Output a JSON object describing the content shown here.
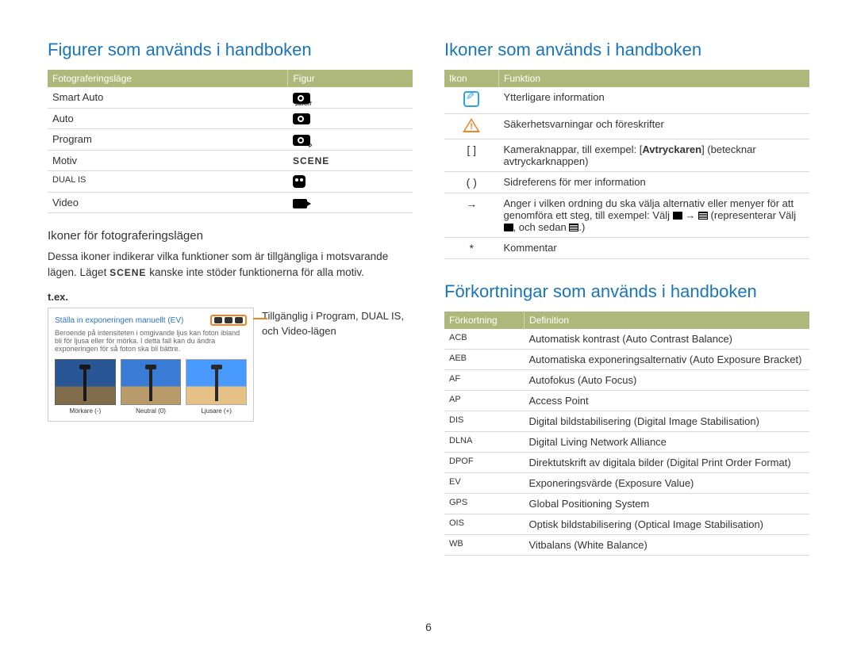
{
  "page_number": "6",
  "left": {
    "heading": "Figurer som används i handboken",
    "table": {
      "cols": [
        "Fotograferingsläge",
        "Figur"
      ],
      "rows": [
        {
          "mode": "Smart Auto",
          "figure": "camera-smart"
        },
        {
          "mode": "Auto",
          "figure": "camera"
        },
        {
          "mode": "Program",
          "figure": "camera-p"
        },
        {
          "mode": "Motiv",
          "figure": "scene"
        },
        {
          "mode": "DUAL IS",
          "figure": "dual-is"
        },
        {
          "mode": "Video",
          "figure": "video"
        }
      ]
    },
    "sub_heading": "Ikoner för fotograferingslägen",
    "intro_pre": "Dessa ikoner indikerar vilka funktioner som är tillgängliga i motsvarande lägen. Läget ",
    "intro_scene_word": "SCENE",
    "intro_post": " kanske inte stöder funktionerna för alla motiv.",
    "tex": "t.ex.",
    "example": {
      "title": "Ställa in exponeringen manuellt (EV)",
      "blurb": "Beroende på intensiteten i omgivande ljus kan foton ibland bli för ljusa eller för mörka. I detta fall kan du ändra exponeringen för så foton ska bli bättre.",
      "thumbs": [
        "Mörkare (-)",
        "Neutral (0)",
        "Ljusare (+)"
      ],
      "annotation": "Tillgänglig i Program, DUAL IS, och Video-lägen"
    }
  },
  "right": {
    "heading_icons": "Ikoner som används i handboken",
    "icons_table": {
      "cols": [
        "Ikon",
        "Funktion"
      ],
      "rows": [
        {
          "icon": "info",
          "text": "Ytterligare information"
        },
        {
          "icon": "warn",
          "text": "Säkerhetsvarningar och föreskrifter"
        },
        {
          "icon": "[ ]",
          "text_pre": "Kameraknappar, till exempel: [",
          "text_bold": "Avtryckaren",
          "text_post": "] (betecknar avtryckarknappen)"
        },
        {
          "icon": "( )",
          "text": "Sidreferens för mer information"
        },
        {
          "icon": "→",
          "text_seq": "Anger i vilken ordning du ska välja alternativ eller menyer för att genomföra ett steg, till exempel: Välj "
        },
        {
          "icon_seq_tail": " (representerar Välj ",
          "tail_mid": ", och sedan ",
          "tail_end": ".)"
        },
        {
          "icon": "*",
          "text": "Kommentar"
        }
      ]
    },
    "heading_abbr": "Förkortningar som används i handboken",
    "abbr_table": {
      "cols": [
        "Förkortning",
        "Definition"
      ],
      "rows": [
        {
          "k": "ACB",
          "v": "Automatisk kontrast (Auto Contrast Balance)"
        },
        {
          "k": "AEB",
          "v": "Automatiska exponeringsalternativ (Auto Exposure Bracket)"
        },
        {
          "k": "AF",
          "v": "Autofokus (Auto Focus)"
        },
        {
          "k": "AP",
          "v": "Access Point"
        },
        {
          "k": "DIS",
          "v": "Digital bildstabilisering (Digital Image Stabilisation)"
        },
        {
          "k": "DLNA",
          "v": "Digital Living Network Alliance"
        },
        {
          "k": "DPOF",
          "v": "Direktutskrift av digitala bilder (Digital Print Order Format)"
        },
        {
          "k": "EV",
          "v": "Exponeringsvärde (Exposure Value)"
        },
        {
          "k": "GPS",
          "v": "Global Positioning System"
        },
        {
          "k": "OIS",
          "v": "Optisk bildstabilisering (Optical Image Stabilisation)"
        },
        {
          "k": "WB",
          "v": "Vitbalans  (White Balance)"
        }
      ]
    }
  }
}
